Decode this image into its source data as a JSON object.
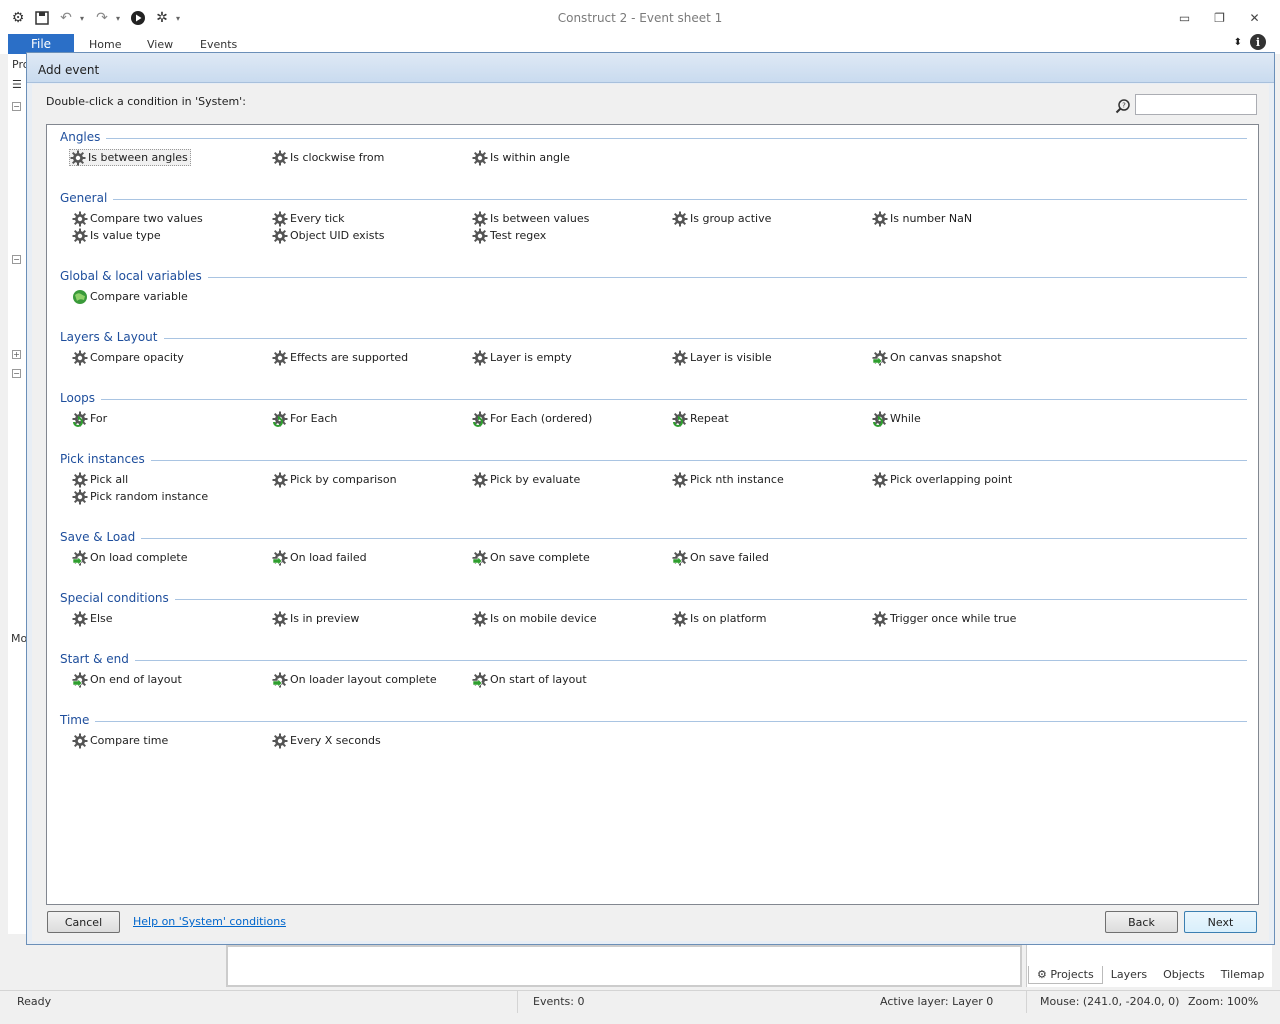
{
  "window": {
    "title": "Construct 2 - Event sheet 1"
  },
  "ribbon": {
    "tabs": [
      "File",
      "Home",
      "View",
      "Events"
    ]
  },
  "left_pane": {
    "top_label": "Pro",
    "mid_label": "Mo"
  },
  "dialog": {
    "title": "Add event",
    "prompt": "Double-click a condition in 'System':",
    "search_placeholder": "",
    "categories": [
      {
        "name": "Angles",
        "items": [
          {
            "label": "Is between angles",
            "icon": "gear-icon",
            "selected": true
          },
          {
            "label": "Is clockwise from",
            "icon": "gear-icon"
          },
          {
            "label": "Is within angle",
            "icon": "gear-icon"
          }
        ]
      },
      {
        "name": "General",
        "items": [
          {
            "label": "Compare two values",
            "icon": "gear-icon"
          },
          {
            "label": "Every tick",
            "icon": "gear-icon"
          },
          {
            "label": "Is between values",
            "icon": "gear-icon"
          },
          {
            "label": "Is group active",
            "icon": "gear-icon"
          },
          {
            "label": "Is number NaN",
            "icon": "gear-icon"
          },
          {
            "label": "Is value type",
            "icon": "gear-icon"
          },
          {
            "label": "Object UID exists",
            "icon": "gear-icon"
          },
          {
            "label": "Test regex",
            "icon": "gear-icon"
          }
        ]
      },
      {
        "name": "Global & local variables",
        "items": [
          {
            "label": "Compare variable",
            "icon": "globe-icon"
          }
        ]
      },
      {
        "name": "Layers & Layout",
        "items": [
          {
            "label": "Compare opacity",
            "icon": "gear-icon"
          },
          {
            "label": "Effects are supported",
            "icon": "gear-icon"
          },
          {
            "label": "Layer is empty",
            "icon": "gear-icon"
          },
          {
            "label": "Layer is visible",
            "icon": "gear-icon"
          },
          {
            "label": "On canvas snapshot",
            "icon": "trigger-icon"
          }
        ]
      },
      {
        "name": "Loops",
        "items": [
          {
            "label": "For",
            "icon": "loop-icon"
          },
          {
            "label": "For Each",
            "icon": "loop-icon"
          },
          {
            "label": "For Each (ordered)",
            "icon": "loop-icon"
          },
          {
            "label": "Repeat",
            "icon": "loop-icon"
          },
          {
            "label": "While",
            "icon": "loop-icon"
          }
        ]
      },
      {
        "name": "Pick instances",
        "items": [
          {
            "label": "Pick all",
            "icon": "gear-icon"
          },
          {
            "label": "Pick by comparison",
            "icon": "gear-icon"
          },
          {
            "label": "Pick by evaluate",
            "icon": "gear-icon"
          },
          {
            "label": "Pick nth instance",
            "icon": "gear-icon"
          },
          {
            "label": "Pick overlapping point",
            "icon": "gear-icon"
          },
          {
            "label": "Pick random instance",
            "icon": "gear-icon"
          }
        ]
      },
      {
        "name": "Save & Load",
        "items": [
          {
            "label": "On load complete",
            "icon": "trigger-icon"
          },
          {
            "label": "On load failed",
            "icon": "trigger-icon"
          },
          {
            "label": "On save complete",
            "icon": "trigger-icon"
          },
          {
            "label": "On save failed",
            "icon": "trigger-icon"
          }
        ]
      },
      {
        "name": "Special conditions",
        "items": [
          {
            "label": "Else",
            "icon": "gear-icon"
          },
          {
            "label": "Is in preview",
            "icon": "gear-icon"
          },
          {
            "label": "Is on mobile device",
            "icon": "gear-icon"
          },
          {
            "label": "Is on platform",
            "icon": "gear-icon"
          },
          {
            "label": "Trigger once while true",
            "icon": "gear-icon"
          }
        ]
      },
      {
        "name": "Start & end",
        "items": [
          {
            "label": "On end of layout",
            "icon": "trigger-icon"
          },
          {
            "label": "On loader layout complete",
            "icon": "trigger-icon"
          },
          {
            "label": "On start of layout",
            "icon": "trigger-icon"
          }
        ]
      },
      {
        "name": "Time",
        "items": [
          {
            "label": "Compare time",
            "icon": "gear-icon"
          },
          {
            "label": "Every X seconds",
            "icon": "gear-icon"
          }
        ]
      }
    ],
    "buttons": {
      "cancel": "Cancel",
      "help": "Help on 'System' conditions",
      "back": "Back",
      "next": "Next"
    }
  },
  "bottom_tabs": [
    "Projects",
    "Layers",
    "Objects",
    "Tilemap"
  ],
  "status": {
    "ready": "Ready",
    "events": "Events: 0",
    "active_layer": "Active layer: Layer 0",
    "mouse": "Mouse: (241.0, -204.0, 0)",
    "zoom": "Zoom: 100%"
  },
  "colors": {
    "accent": "#2b6fc7",
    "category_text": "#1e4e9c",
    "link": "#0066cc"
  }
}
